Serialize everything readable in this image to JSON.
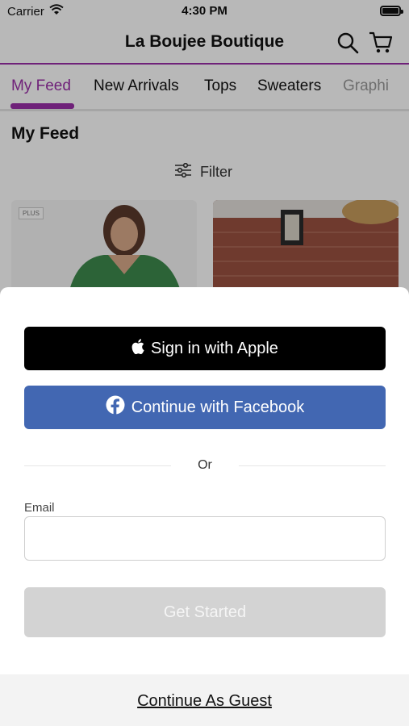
{
  "status_bar": {
    "carrier": "Carrier",
    "time": "4:30 PM"
  },
  "header": {
    "title": "La Boujee Boutique",
    "icons": [
      "search-icon",
      "cart-icon"
    ]
  },
  "tabs": [
    {
      "label": "My Feed",
      "active": true
    },
    {
      "label": "New Arrivals",
      "active": false
    },
    {
      "label": "Tops",
      "active": false
    },
    {
      "label": "Sweaters",
      "active": false
    },
    {
      "label": "Graphi",
      "active": false
    }
  ],
  "feed": {
    "title": "My Feed",
    "filter_label": "Filter",
    "cards": [
      {
        "badge": "PLUS"
      }
    ]
  },
  "sheet": {
    "apple_label": "Sign in with Apple",
    "facebook_label": "Continue with Facebook",
    "or_text": "Or",
    "email_label": "Email",
    "email_value": "",
    "email_placeholder": "",
    "get_started_label": "Get Started",
    "guest_label": "Continue As Guest"
  },
  "colors": {
    "accent": "#9a2fa8",
    "facebook": "#4267b2",
    "disabled": "#d3d3d3"
  }
}
